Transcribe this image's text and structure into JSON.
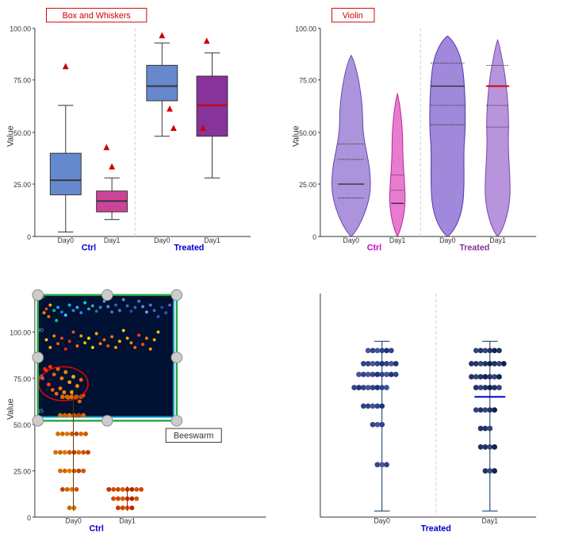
{
  "charts": {
    "box_whiskers": {
      "title": "Box and Whiskers",
      "y_label": "Value",
      "x_groups": [
        "Ctrl",
        "Treated"
      ],
      "x_days": [
        "Day0",
        "Day1",
        "Day0",
        "Day1"
      ],
      "y_max": 100,
      "y_ticks": [
        0,
        25,
        50,
        75,
        100
      ]
    },
    "violin": {
      "title": "Violin",
      "y_label": "Value",
      "x_groups": [
        "Ctrl",
        "Treated"
      ],
      "y_max": 100,
      "y_ticks": [
        0,
        25,
        50,
        75,
        100
      ]
    },
    "beeswarm": {
      "title": "Beeswarm",
      "y_label": "Value",
      "x_groups": [
        "Ctrl",
        "Treated"
      ],
      "y_max": 120,
      "y_ticks": [
        0,
        25,
        50,
        75,
        100
      ]
    }
  }
}
